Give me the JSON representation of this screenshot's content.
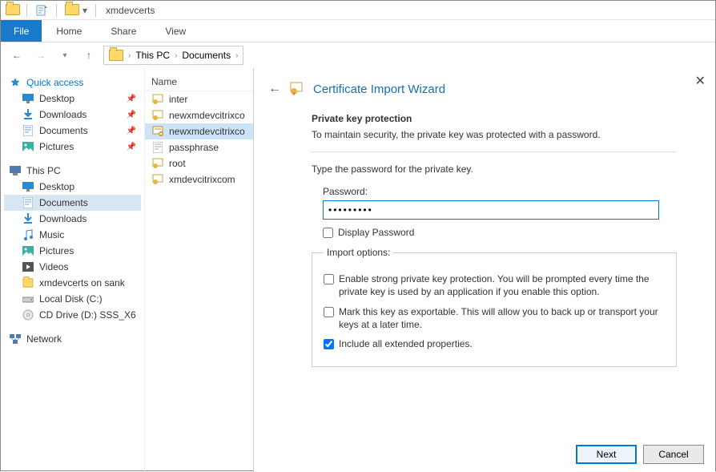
{
  "titlebar": {
    "title": "xmdevcerts"
  },
  "ribbon": {
    "file": "File",
    "home": "Home",
    "share": "Share",
    "view": "View"
  },
  "breadcrumb": {
    "root": "This PC",
    "folder": "Documents",
    "chevron": "›"
  },
  "tree": {
    "quick_access": "Quick access",
    "qa_items": [
      {
        "label": "Desktop"
      },
      {
        "label": "Downloads"
      },
      {
        "label": "Documents"
      },
      {
        "label": "Pictures"
      }
    ],
    "this_pc": "This PC",
    "pc_items": [
      {
        "label": "Desktop"
      },
      {
        "label": "Documents"
      },
      {
        "label": "Downloads"
      },
      {
        "label": "Music"
      },
      {
        "label": "Pictures"
      },
      {
        "label": "Videos"
      },
      {
        "label": "xmdevcerts on sank"
      },
      {
        "label": "Local Disk (C:)"
      },
      {
        "label": "CD Drive (D:) SSS_X6"
      }
    ],
    "network": "Network"
  },
  "filelist": {
    "col_name": "Name",
    "items": [
      {
        "label": "inter"
      },
      {
        "label": "newxmdevcitrixco"
      },
      {
        "label": "newxmdevcitrixco"
      },
      {
        "label": "passphrase"
      },
      {
        "label": "root"
      },
      {
        "label": "xmdevcitrixcom"
      }
    ]
  },
  "wizard": {
    "title": "Certificate Import Wizard",
    "section_title": "Private key protection",
    "section_text": "To maintain security, the private key was protected with a password.",
    "instruction": "Type the password for the private key.",
    "password_label": "Password:",
    "password_value": "•••••••••",
    "display_password": "Display Password",
    "import_legend": "Import options:",
    "opt_strong": "Enable strong private key protection. You will be prompted every time the private key is used by an application if you enable this option.",
    "opt_export": "Mark this key as exportable. This will allow you to back up or transport your keys at a later time.",
    "opt_extended": "Include all extended properties.",
    "btn_next": "Next",
    "btn_cancel": "Cancel"
  }
}
